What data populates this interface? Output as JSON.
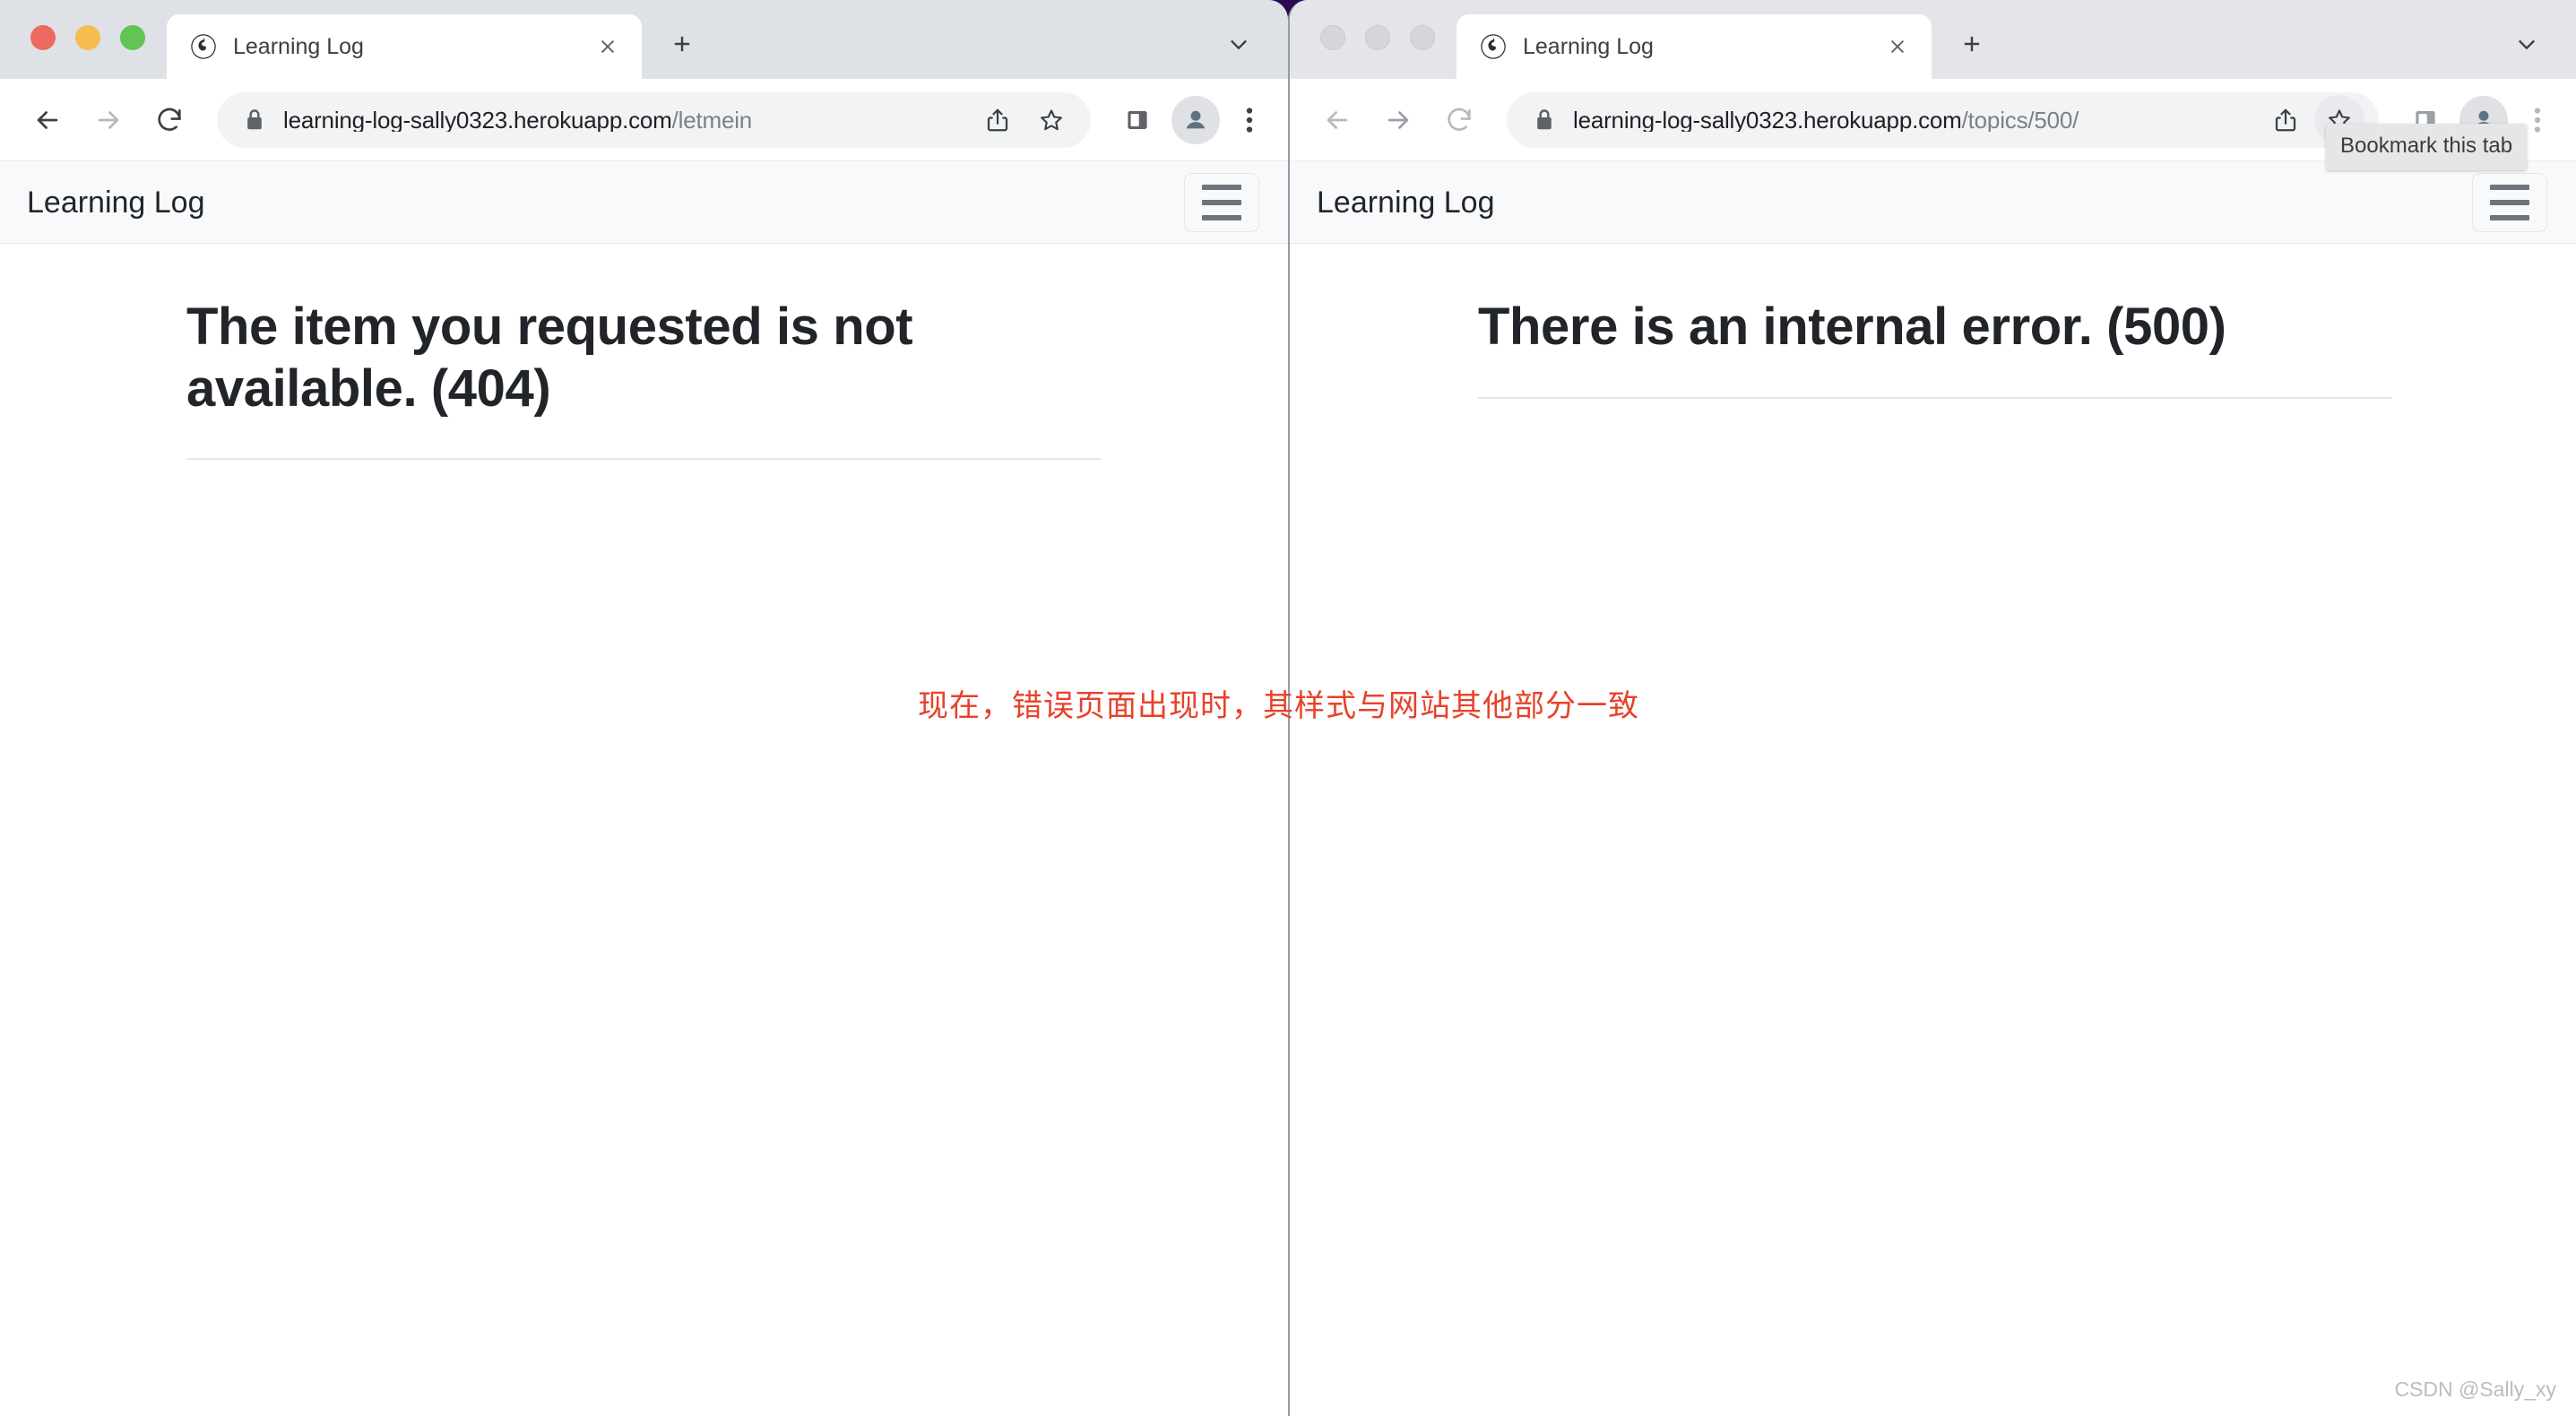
{
  "desktop": {
    "background_color": "#2b0a52",
    "watermark": "CSDN @Sally_xy"
  },
  "annotation": {
    "text": "现在，错误页面出现时，其样式与网站其他部分一致",
    "color": "#e8412a"
  },
  "windows": [
    {
      "id": "left-window",
      "focused": true,
      "traffic_lights": {
        "close": "close-window",
        "minimize": "minimize-window",
        "maximize": "maximize-window",
        "colors": [
          "#ed6a5e",
          "#f5bd4f",
          "#61c454"
        ]
      },
      "tab": {
        "favicon": "globe-icon",
        "title": "Learning Log",
        "close_label": "×"
      },
      "new_tab_label": "+",
      "tab_list_chevron": "chevron-down-icon",
      "toolbar": {
        "back": "back-arrow-icon",
        "forward": "forward-arrow-icon",
        "reload": "reload-icon",
        "lock": "lock-icon",
        "url_domain": "learning-log-sally0323.herokuapp.com",
        "url_path": "/letmein",
        "share": "share-icon",
        "bookmark": "star-icon",
        "side_panel": "side-panel-icon",
        "profile": "avatar-icon",
        "menu": "three-dot-menu-icon",
        "bookmark_hovered": false
      },
      "page": {
        "navbar": {
          "brand": "Learning Log",
          "toggle": "hamburger-icon",
          "background_color": "#f8f9fa"
        },
        "heading": "The item you requested is not available. (404)",
        "has_divider": true
      }
    },
    {
      "id": "right-window",
      "focused": false,
      "traffic_lights": {
        "close": "close-window",
        "minimize": "minimize-window",
        "maximize": "maximize-window",
        "colors": [
          "#d5d6db",
          "#d5d6db",
          "#d5d6db"
        ]
      },
      "tab": {
        "favicon": "globe-icon",
        "title": "Learning Log",
        "close_label": "×"
      },
      "new_tab_label": "+",
      "tab_list_chevron": "chevron-down-icon",
      "toolbar": {
        "back": "back-arrow-icon",
        "forward": "forward-arrow-icon",
        "reload": "reload-icon",
        "lock": "lock-icon",
        "url_domain": "learning-log-sally0323.herokuapp.com",
        "url_path": "/topics/500/",
        "share": "share-icon",
        "bookmark": "star-icon",
        "side_panel": "side-panel-icon",
        "profile": "avatar-icon",
        "menu": "three-dot-menu-icon",
        "bookmark_hovered": true,
        "tooltip": "Bookmark this tab"
      },
      "page": {
        "navbar": {
          "brand": "Learning Log",
          "toggle": "hamburger-icon",
          "background_color": "#f8f9fa"
        },
        "heading": "There is an internal error. (500)",
        "has_divider": true
      }
    }
  ]
}
